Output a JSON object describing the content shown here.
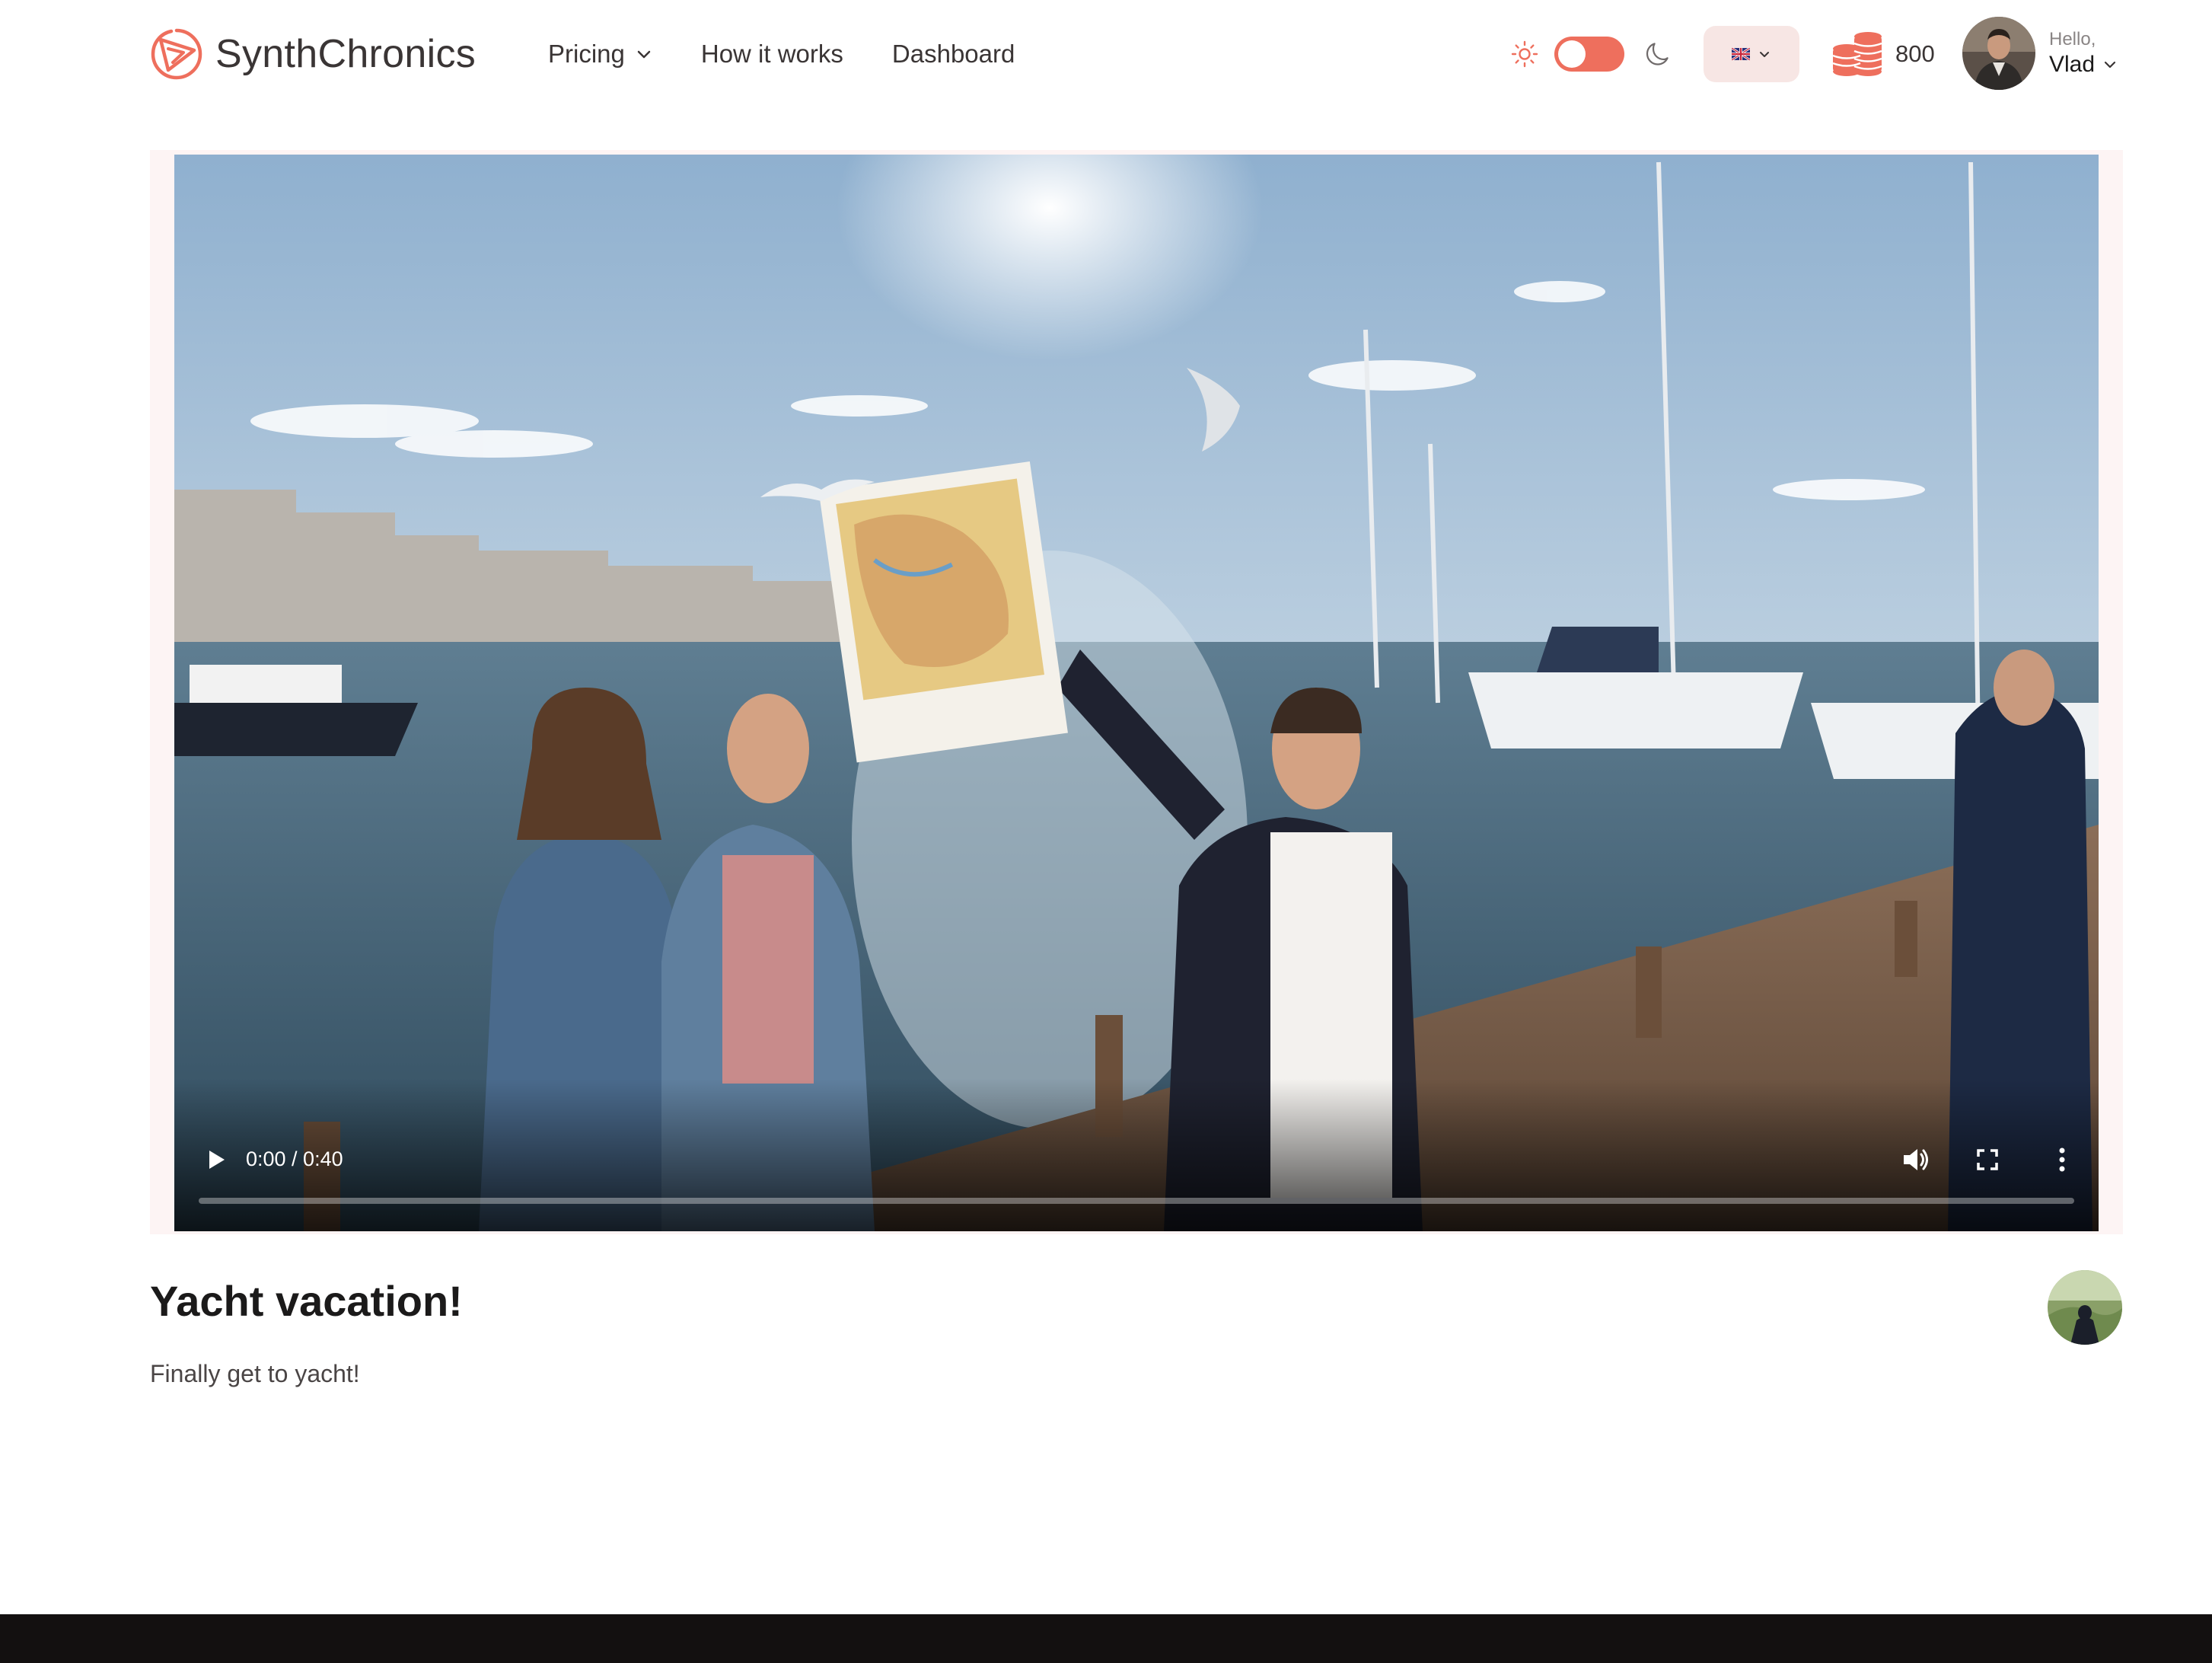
{
  "header": {
    "brand": "SynthChronics",
    "brand_icon": "synthchronics-logo-icon",
    "nav": {
      "pricing": "Pricing",
      "how_it_works": "How it works",
      "dashboard": "Dashboard"
    },
    "theme": {
      "mode": "light",
      "sun_icon": "sun-icon",
      "moon_icon": "moon-icon"
    },
    "language": {
      "flag": "uk-flag-icon"
    },
    "credits": {
      "value": "800",
      "icon": "coins-stack-icon"
    },
    "user": {
      "greeting": "Hello,",
      "name": "Vlad"
    }
  },
  "video": {
    "time": "0:00 / 0:40",
    "progress": 0.0,
    "controls": [
      "play-icon",
      "volume-icon",
      "fullscreen-icon",
      "more-vert-icon"
    ]
  },
  "post": {
    "title": "Yacht vacation!",
    "description": "Finally get to yacht!"
  },
  "colors": {
    "accent": "#ee6f5d",
    "lang_bg": "#f7e6e4",
    "footer": "#131010"
  }
}
